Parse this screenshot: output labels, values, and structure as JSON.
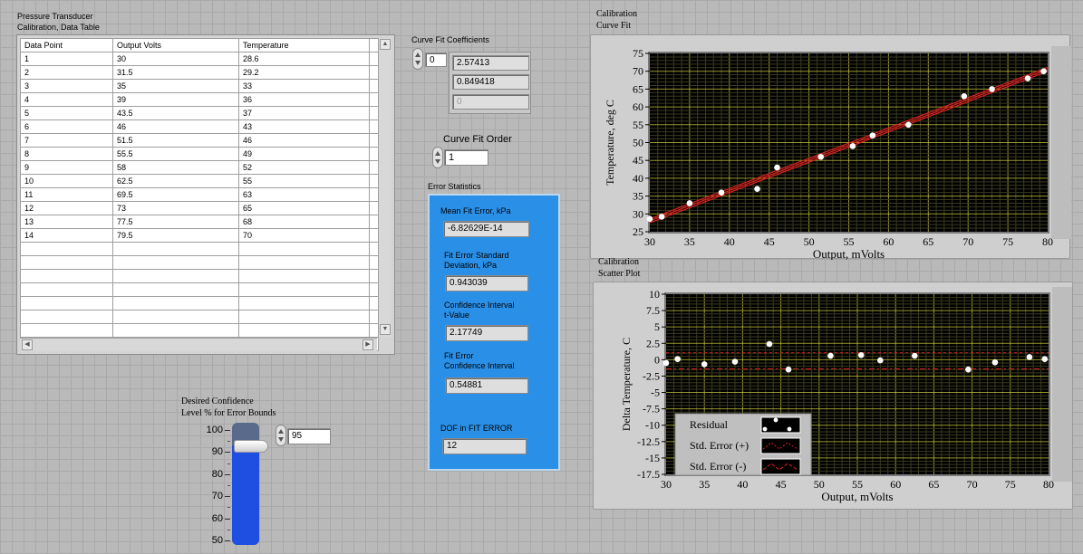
{
  "table": {
    "title": "Pressure Transducer\nCalibration, Data Table",
    "columns": [
      "Data Point",
      "Output Volts",
      "Temperature"
    ],
    "rows": [
      [
        "1",
        "30",
        "28.6"
      ],
      [
        "2",
        "31.5",
        "29.2"
      ],
      [
        "3",
        "35",
        "33"
      ],
      [
        "4",
        "39",
        "36"
      ],
      [
        "5",
        "43.5",
        "37"
      ],
      [
        "6",
        "46",
        "43"
      ],
      [
        "7",
        "51.5",
        "46"
      ],
      [
        "8",
        "55.5",
        "49"
      ],
      [
        "9",
        "58",
        "52"
      ],
      [
        "10",
        "62.5",
        "55"
      ],
      [
        "11",
        "69.5",
        "63"
      ],
      [
        "12",
        "73",
        "65"
      ],
      [
        "13",
        "77.5",
        "68"
      ],
      [
        "14",
        "79.5",
        "70"
      ]
    ],
    "empty_rows": 8
  },
  "coeffs": {
    "label": "Curve Fit Coefficients",
    "index": "0",
    "values": [
      "2.57413",
      "0.849418",
      "0"
    ]
  },
  "fit_order": {
    "label": "Curve Fit Order",
    "value": "1"
  },
  "error_stats": {
    "label": "Error Statistics",
    "mean_label": "Mean Fit Error, kPa",
    "mean_value": "-6.82629E-14",
    "std_label": "Fit Error Standard\nDeviation, kPa",
    "std_value": "0.943039",
    "t_label": "Confidence Interval\nt-Value",
    "t_value": "2.17749",
    "ci_label": "Fit Error\nConfidence Interval",
    "ci_value": "0.54881",
    "dof_label": "DOF in FIT ERROR",
    "dof_value": "12"
  },
  "confidence": {
    "label": "Desired Confidence\nLevel % for Error Bounds",
    "value": "95",
    "level": 95,
    "scale": [
      "100",
      "90",
      "80",
      "70",
      "60",
      "50"
    ],
    "fill_color": "#1e4fe0"
  },
  "chart_data": [
    {
      "type": "scatter",
      "title": "Calibration\nCurve Fit",
      "xlabel": "Output, mVolts",
      "ylabel": "Temperature, deg C",
      "xlim": [
        30,
        80
      ],
      "ylim": [
        25,
        75
      ],
      "xticks": [
        "30",
        "35",
        "40",
        "45",
        "50",
        "55",
        "60",
        "65",
        "70",
        "75",
        "80"
      ],
      "yticks": [
        "75",
        "70",
        "65",
        "60",
        "55",
        "50",
        "45",
        "40",
        "35",
        "30",
        "25"
      ],
      "grid": true,
      "background": "#000000",
      "grid_color": "#c8c83c",
      "points": {
        "x": [
          30,
          31.5,
          35,
          39,
          43.5,
          46,
          51.5,
          55.5,
          58,
          62.5,
          69.5,
          73,
          77.5,
          79.5
        ],
        "y": [
          28.6,
          29.2,
          33,
          36,
          37,
          43,
          46,
          49,
          52,
          55,
          63,
          65,
          68,
          70
        ]
      },
      "fit_line": {
        "slope": 0.849418,
        "intercept": 2.57413,
        "band": 0.54881,
        "color": "#e02020"
      }
    },
    {
      "type": "scatter",
      "title": "Calibration\nScatter Plot",
      "xlabel": "Output, mVolts",
      "ylabel": "Delta Temperature, C",
      "xlim": [
        30,
        80
      ],
      "ylim": [
        -17.5,
        10
      ],
      "xticks": [
        "30",
        "35",
        "40",
        "45",
        "50",
        "55",
        "60",
        "65",
        "70",
        "75",
        "80"
      ],
      "yticks": [
        "10",
        "7.5",
        "5",
        "2.5",
        "0",
        "-2.5",
        "-5",
        "-7.5",
        "-10",
        "-12.5",
        "-15",
        "-17.5"
      ],
      "grid": true,
      "background": "#000000",
      "grid_color": "#c8c83c",
      "series": [
        {
          "name": "Residual",
          "x": [
            30,
            31.5,
            35,
            39,
            43.5,
            46,
            51.5,
            55.5,
            58,
            62.5,
            69.5,
            73,
            77.5,
            79.5
          ],
          "y": [
            -0.5,
            0.1,
            -0.7,
            -0.3,
            2.4,
            -1.5,
            0.6,
            0.7,
            -0.1,
            0.6,
            -1.5,
            -0.4,
            0.4,
            0.1
          ]
        },
        {
          "name": "Std. Error (+)",
          "value": 1.05,
          "color": "#e02020"
        },
        {
          "name": "Std. Error (-)",
          "value": -1.4,
          "color": "#e02020"
        }
      ],
      "legend": "bottom-left"
    }
  ]
}
